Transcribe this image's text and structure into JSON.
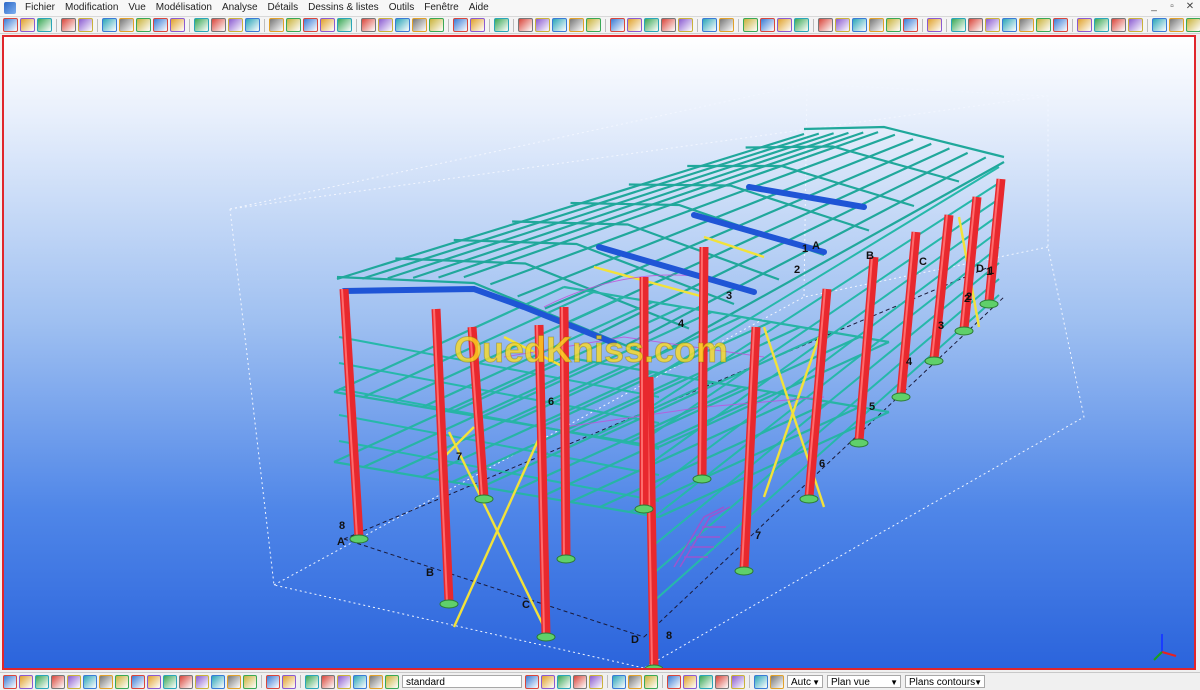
{
  "menubar": {
    "items": [
      "Fichier",
      "Modification",
      "Vue",
      "Modélisation",
      "Analyse",
      "Détails",
      "Dessins & listes",
      "Outils",
      "Fenêtre",
      "Aide"
    ],
    "window_controls": [
      "_",
      "▫",
      "✕"
    ]
  },
  "viewport": {
    "watermark": "OuedKniss.com",
    "grid_labels_front": [
      "8",
      "A",
      "B",
      "C",
      "D",
      "8"
    ],
    "grid_labels_side": [
      "7",
      "6",
      "5",
      "4",
      "3",
      "2",
      "1"
    ],
    "grid_labels_back": [
      "1",
      "A",
      "B",
      "C",
      "D",
      "1",
      "2"
    ],
    "grid_labels_interior": [
      "7",
      "6",
      "4",
      "3",
      "2"
    ],
    "axis_labels": [
      "z",
      "x",
      "y"
    ]
  },
  "statusbar": {
    "view_name": "standard",
    "select_auto": "Autc",
    "select_plane": "Plan vue",
    "select_contours": "Plans contours"
  },
  "colors": {
    "column": "#e8282e",
    "beam": "#22b3a6",
    "ridge_beam": "#1f55d6",
    "bracing": "#f2e23a",
    "frame_border": "#e0262b"
  }
}
